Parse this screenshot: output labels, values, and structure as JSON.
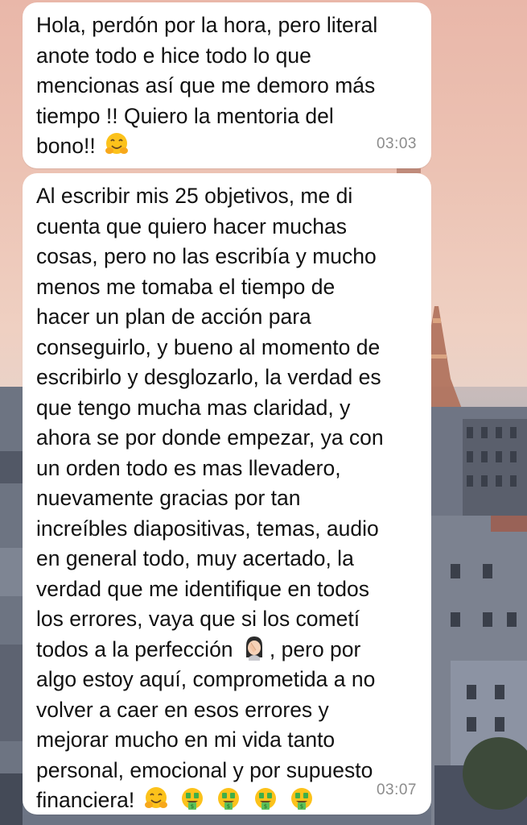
{
  "conversation": {
    "messages": [
      {
        "lines": [
          "Hola, perdón por la hora, pero literal",
          "anote todo e hice todo lo que",
          "mencionas así que me demoro más",
          "tiempo !! Quiero la mentoria del",
          "bono!!"
        ],
        "trailing_emoji": "hugging-face-emoji",
        "time": "03:03"
      },
      {
        "lines": [
          "Al escribir mis 25 objetivos, me di",
          "cuenta que quiero hacer muchas",
          "cosas, pero no las escribía y mucho",
          "menos me tomaba el tiempo de",
          "hacer un plan de acción para",
          "conseguirlo, y bueno al momento de",
          "escribirlo y desglozarlo, la verdad es",
          "que tengo mucha mas claridad, y",
          "ahora se por donde empezar, ya con",
          "un orden todo es mas llevadero,",
          "nuevamente gracias por tan",
          "increíbles diapositivas, temas, audio",
          "en general todo, muy acertado, la",
          "verdad que me identifique en todos",
          "los errores, vaya que si los cometí"
        ],
        "line_16_before": "todos a la perfección",
        "line_16_after": ", pero por",
        "lines_after": [
          "algo estoy aquí, comprometida a no",
          "volver a caer en esos errores y",
          "mejorar mucho en mi vida tanto",
          "personal, emocional y por supuesto"
        ],
        "last_line": "financiera!",
        "emojis": [
          "hugging-face-emoji",
          "money-mouth-face-emoji",
          "money-mouth-face-emoji",
          "money-mouth-face-emoji",
          "money-mouth-face-emoji"
        ],
        "inline_emoji": "woman-facepalming-emoji",
        "time": "03:07"
      }
    ]
  }
}
